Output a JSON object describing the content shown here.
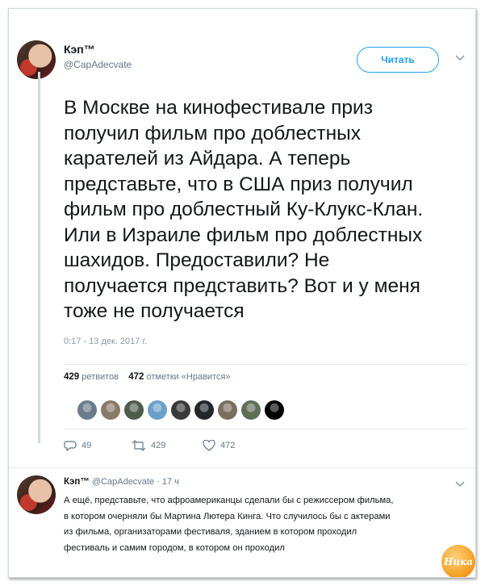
{
  "tweet": {
    "author_name": "Кэп™",
    "author_handle": "@CapAdecvate",
    "follow_label": "Читать",
    "text_lines": [
      "В Москве на кинофестивале приз",
      "получил фильм про доблестных",
      "карателей из Айдара. А теперь",
      "представьте, что в США приз получил",
      "фильм про доблестный Ку-Клукс-Клан.",
      "Или в Израиле фильм про доблестных",
      "шахидов. Предоставили? Не",
      "получается представить? Вот и у меня",
      "тоже не получается"
    ],
    "timestamp": "0:17 - 13 дек. 2017 г.",
    "retweets_count": "429",
    "retweets_label": "ретвитов",
    "likes_count": "472",
    "likes_label": "отметки «Нравится»",
    "actions": {
      "replies": "49",
      "retweets": "429",
      "likes": "472"
    },
    "liker_colors": [
      "#6b7b8c",
      "#8a7a6a",
      "#4e5d4a",
      "#6aa0c8",
      "#3a3a3a",
      "#23262b",
      "#7a6f60",
      "#5e6e58",
      "#000000"
    ]
  },
  "reply": {
    "author_name": "Кэп™",
    "author_handle": "@CapAdecvate",
    "time": "· 17 ч",
    "text_lines": [
      "А ещё, представьте, что афроамериканцы сделали бы с режиссером фильма,",
      "в котором очерняли бы Мартина Лютера Кинга. Что случилось бы с актерами",
      "из фильма, организаторами фестиваля, зданием в котором проходил",
      "фестиваль и самим городом, в котором он проходил"
    ]
  },
  "watermark": "Ника"
}
